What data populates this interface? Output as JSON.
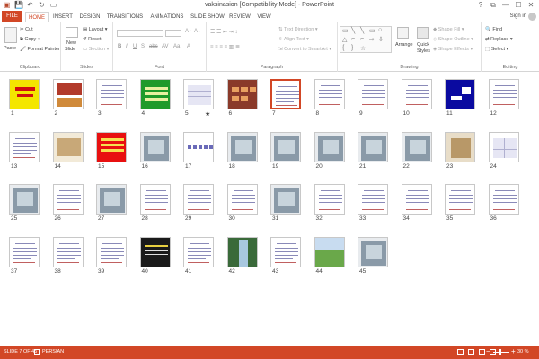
{
  "window": {
    "title": "vaksinasion [Compatibility Mode] - PowerPoint",
    "buttons": [
      "?",
      "⧉",
      "—",
      "☐",
      "✕"
    ]
  },
  "qat": {
    "save_icon": "save-icon",
    "undo_icon": "undo-icon",
    "redo_icon": "redo-icon",
    "present_icon": "present-icon"
  },
  "tabs": [
    {
      "label": "FILE"
    },
    {
      "label": "HOME"
    },
    {
      "label": "INSERT"
    },
    {
      "label": "DESIGN"
    },
    {
      "label": "TRANSITIONS"
    },
    {
      "label": "ANIMATIONS"
    },
    {
      "label": "SLIDE SHOW"
    },
    {
      "label": "REVIEW"
    },
    {
      "label": "VIEW"
    }
  ],
  "signin": "Sign in",
  "ribbon": {
    "clipboard": {
      "paste": "Paste",
      "cut": "Cut",
      "copy": "Copy",
      "format_painter": "Format Painter",
      "label": "Clipboard"
    },
    "slides": {
      "new_slide": "New",
      "new_slide2": "Slide",
      "layout": "Layout",
      "reset": "Reset",
      "section": "Section",
      "label": "Slides"
    },
    "font": {
      "label": "Font",
      "buttons": [
        "B",
        "I",
        "U",
        "S",
        "abc",
        "AV",
        "Aa",
        "A"
      ]
    },
    "paragraph": {
      "text_direction": "Text Direction",
      "align_text": "Align Text",
      "convert_smartart": "Convert to SmartArt",
      "label": "Paragraph"
    },
    "drawing": {
      "arrange": "Arrange",
      "quick_styles": "Quick",
      "quick_styles2": "Styles",
      "shape_fill": "Shape Fill",
      "shape_outline": "Shape Outline",
      "shape_effects": "Shape Effects",
      "label": "Drawing"
    },
    "editing": {
      "find": "Find",
      "replace": "Replace",
      "select": "Select",
      "label": "Editing"
    }
  },
  "slides": [
    {
      "num": "1",
      "style": "yellow"
    },
    {
      "num": "2",
      "style": "redtitle"
    },
    {
      "num": "3",
      "style": "text"
    },
    {
      "num": "4",
      "style": "green"
    },
    {
      "num": "5",
      "style": "table",
      "star": "★"
    },
    {
      "num": "6",
      "style": "brown"
    },
    {
      "num": "7",
      "style": "text",
      "selected": true
    },
    {
      "num": "8",
      "style": "text"
    },
    {
      "num": "9",
      "style": "text"
    },
    {
      "num": "10",
      "style": "text"
    },
    {
      "num": "11",
      "style": "blue"
    },
    {
      "num": "12",
      "style": "text"
    },
    {
      "num": "13",
      "style": "text"
    },
    {
      "num": "14",
      "style": "beige"
    },
    {
      "num": "15",
      "style": "red"
    },
    {
      "num": "16",
      "style": "photo"
    },
    {
      "num": "17",
      "style": "dots"
    },
    {
      "num": "18",
      "style": "photo"
    },
    {
      "num": "19",
      "style": "photo"
    },
    {
      "num": "20",
      "style": "photo"
    },
    {
      "num": "21",
      "style": "photo"
    },
    {
      "num": "22",
      "style": "photo"
    },
    {
      "num": "23",
      "style": "box"
    },
    {
      "num": "24",
      "style": "table"
    },
    {
      "num": "25",
      "style": "photo"
    },
    {
      "num": "26",
      "style": "text"
    },
    {
      "num": "27",
      "style": "photo"
    },
    {
      "num": "28",
      "style": "text"
    },
    {
      "num": "29",
      "style": "text"
    },
    {
      "num": "30",
      "style": "text"
    },
    {
      "num": "31",
      "style": "photo"
    },
    {
      "num": "32",
      "style": "text"
    },
    {
      "num": "33",
      "style": "text"
    },
    {
      "num": "34",
      "style": "text"
    },
    {
      "num": "35",
      "style": "text"
    },
    {
      "num": "36",
      "style": "text"
    },
    {
      "num": "37",
      "style": "text"
    },
    {
      "num": "38",
      "style": "text"
    },
    {
      "num": "39",
      "style": "text"
    },
    {
      "num": "40",
      "style": "dark"
    },
    {
      "num": "41",
      "style": "text"
    },
    {
      "num": "42",
      "style": "waterfall"
    },
    {
      "num": "43",
      "style": "text"
    },
    {
      "num": "44",
      "style": "field"
    },
    {
      "num": "45",
      "style": "photo"
    }
  ],
  "status": {
    "slide_info": "SLIDE 7 OF 45",
    "language": "PERSIAN",
    "zoom": "30 %",
    "zoom_minus": "−",
    "zoom_plus": "+"
  },
  "colors": {
    "accent": "#d24726"
  }
}
